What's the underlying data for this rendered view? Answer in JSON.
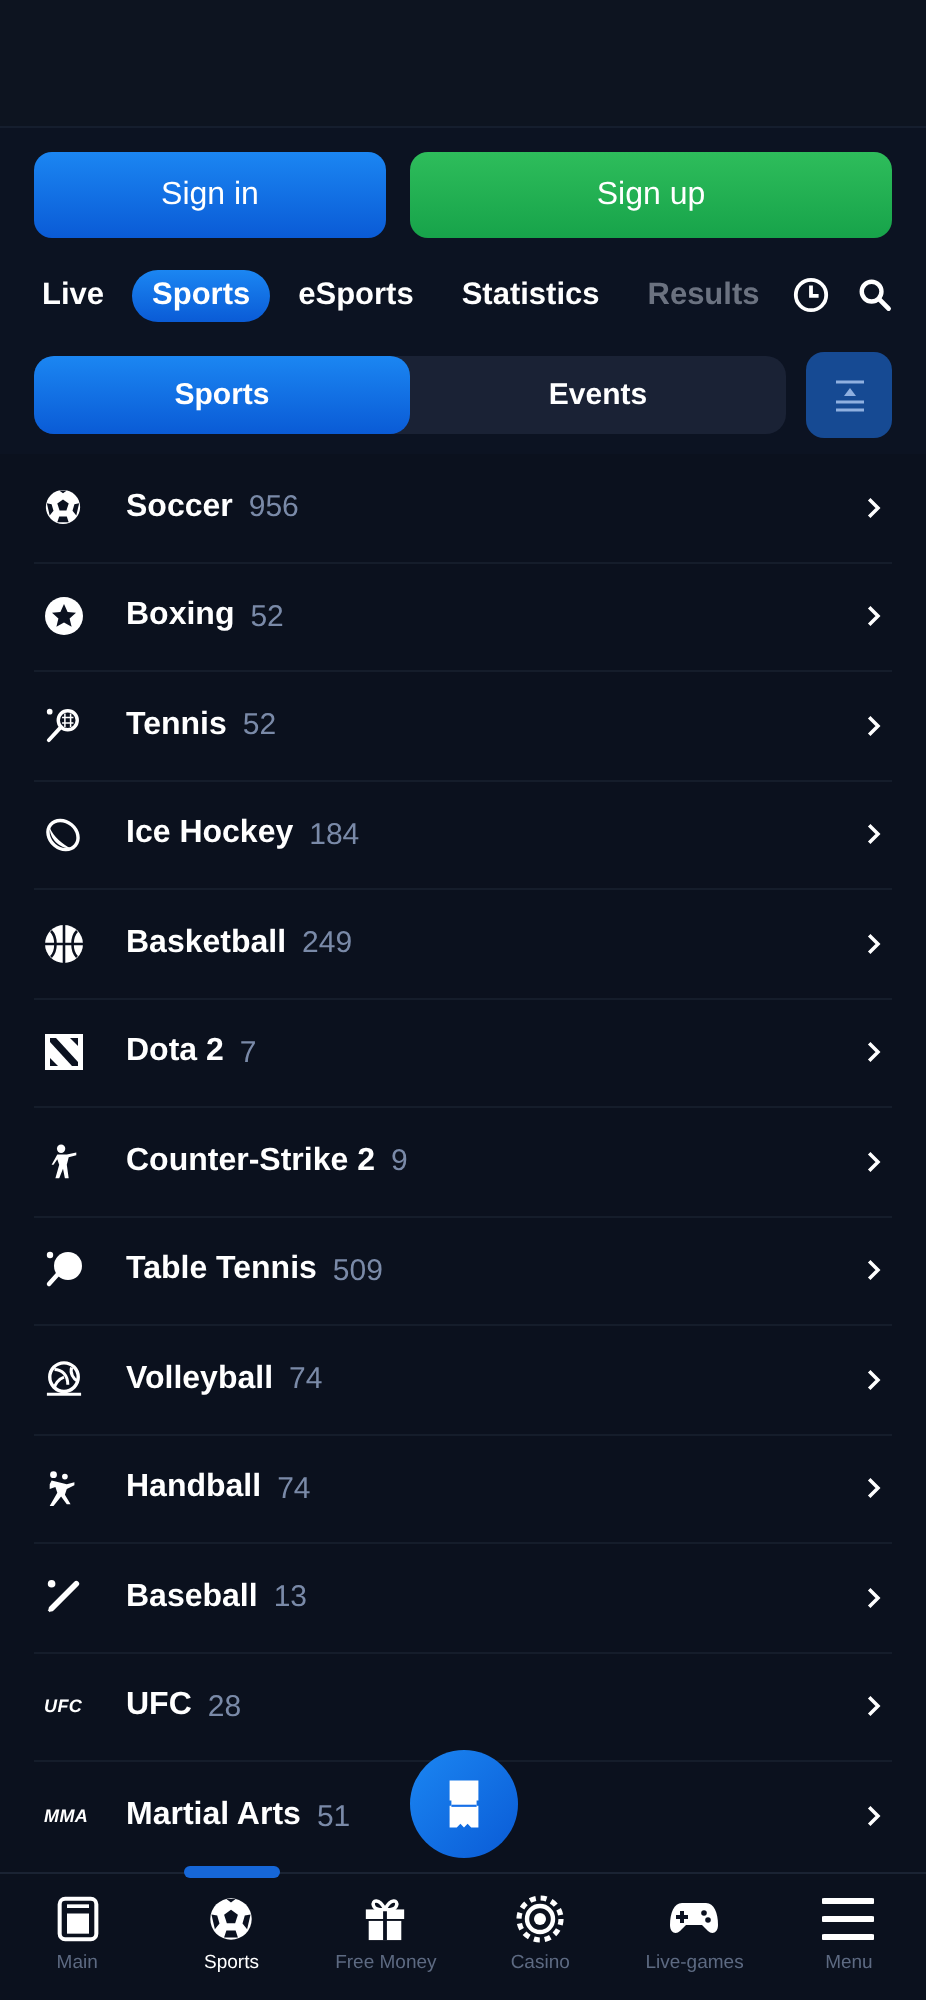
{
  "auth": {
    "sign_in": "Sign in",
    "sign_up": "Sign up"
  },
  "tabs": [
    {
      "label": "Live",
      "selected": false
    },
    {
      "label": "Sports",
      "selected": true
    },
    {
      "label": "eSports",
      "selected": false
    },
    {
      "label": "Statistics",
      "selected": false
    },
    {
      "label": "Results",
      "selected": false
    }
  ],
  "segments": [
    {
      "label": "Sports",
      "selected": true
    },
    {
      "label": "Events",
      "selected": false
    }
  ],
  "sports": [
    {
      "kind": "soccer",
      "name": "Soccer",
      "count": "956"
    },
    {
      "kind": "boxing",
      "name": "Boxing",
      "count": "52"
    },
    {
      "kind": "tennis",
      "name": "Tennis",
      "count": "52"
    },
    {
      "kind": "hockey",
      "name": "Ice Hockey",
      "count": "184"
    },
    {
      "kind": "basketball",
      "name": "Basketball",
      "count": "249"
    },
    {
      "kind": "dota",
      "name": "Dota 2",
      "count": "7"
    },
    {
      "kind": "shooter",
      "name": "Counter-Strike 2",
      "count": "9"
    },
    {
      "kind": "tabletennis",
      "name": "Table Tennis",
      "count": "509"
    },
    {
      "kind": "volleyball",
      "name": "Volleyball",
      "count": "74"
    },
    {
      "kind": "handball",
      "name": "Handball",
      "count": "74"
    },
    {
      "kind": "baseball",
      "name": "Baseball",
      "count": "13"
    },
    {
      "kind": "logo",
      "logo": "UFC",
      "name": "UFC",
      "count": "28"
    },
    {
      "kind": "logo",
      "logo": "MMA",
      "name": "Martial Arts",
      "count": "51"
    }
  ],
  "nav": [
    {
      "kind": "main",
      "label": "Main",
      "selected": false
    },
    {
      "kind": "sports",
      "label": "Sports",
      "selected": true
    },
    {
      "kind": "gift",
      "label": "Free Money",
      "selected": false
    },
    {
      "kind": "casino",
      "label": "Casino",
      "selected": false
    },
    {
      "kind": "games",
      "label": "Live-games",
      "selected": false
    },
    {
      "kind": "menu",
      "label": "Menu",
      "selected": false
    }
  ]
}
